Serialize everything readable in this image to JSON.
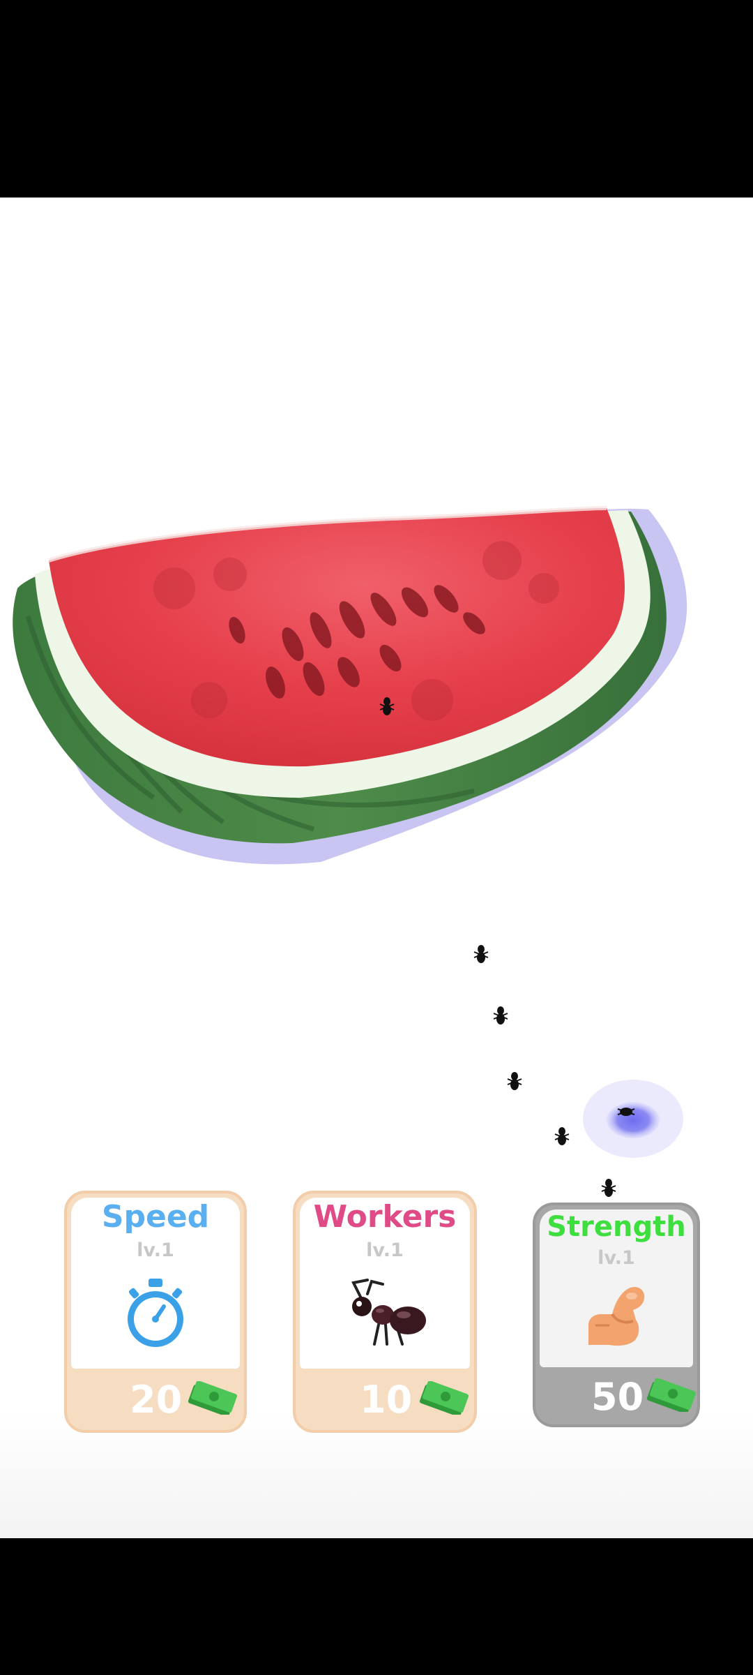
{
  "upgrades": [
    {
      "title": "Speed",
      "level": "lv.1",
      "price": "20",
      "icon": "stopwatch-icon",
      "title_color": "#5aaff0",
      "state": "available"
    },
    {
      "title": "Workers",
      "level": "lv.1",
      "price": "10",
      "icon": "ant-icon",
      "title_color": "#e04a86",
      "state": "available"
    },
    {
      "title": "Strength",
      "level": "lv.1",
      "price": "50",
      "icon": "flexed-arm-icon",
      "title_color": "#3fde3f",
      "state": "locked"
    }
  ],
  "currency_icon": "cash-bills-icon",
  "scene": {
    "food_item": "watermelon-slice",
    "ant_trail_count": 6,
    "anthill_icon": "anthill-hole-icon"
  },
  "colors": {
    "card_orange": "#f6dcc1",
    "card_gray": "#a7a7a7",
    "shadow_purple": "#b7b1ee"
  }
}
